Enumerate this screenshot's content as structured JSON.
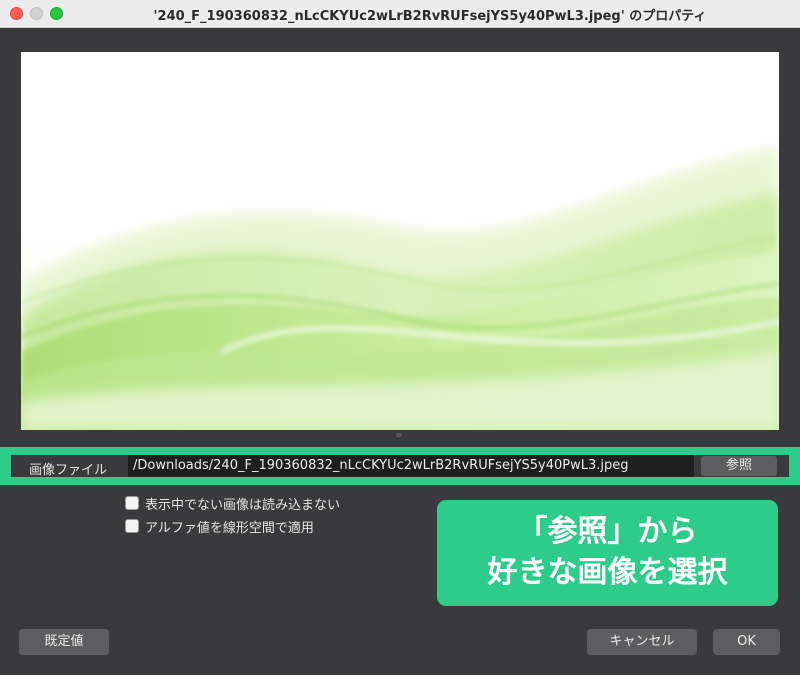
{
  "window": {
    "title": "'240_F_190360832_nLcCKYUc2wLrB2RvRUFsejYS5y40PwL3.jpeg' のプロパティ"
  },
  "colors": {
    "accent": "#2ecc8a",
    "window_bg": "#3a393b",
    "button_bg": "#5d5c5e",
    "path_field_bg": "#1f1f1f"
  },
  "file": {
    "label": "画像ファイル",
    "path": "/Downloads/240_F_190360832_nLcCKYUc2wLrB2RvRUFsejYS5y40PwL3.jpeg",
    "browse_label": "参照"
  },
  "options": [
    {
      "label": "表示中でない画像は読み込まない",
      "checked": false
    },
    {
      "label": "アルファ値を線形空間で適用",
      "checked": false
    }
  ],
  "callout": {
    "line1": "「参照」から",
    "line2": "好きな画像を選択"
  },
  "buttons": {
    "defaults_label": "既定値",
    "cancel_label": "キャンセル",
    "ok_label": "OK"
  }
}
